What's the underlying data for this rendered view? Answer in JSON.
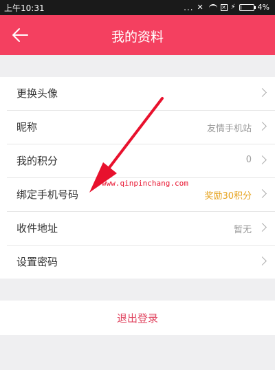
{
  "status_bar": {
    "time": "上午10:31",
    "dots": "...",
    "battery_percent": "4%",
    "battery_level": 0.04,
    "icons": [
      "signal-dots-icon",
      "mute-icon",
      "wifi-icon",
      "sim-icon",
      "charging-icon",
      "battery-icon"
    ]
  },
  "header": {
    "title": "我的资料",
    "back_icon": "back-arrow-icon",
    "color": "#f44060"
  },
  "rows": [
    {
      "label": "更换头像",
      "value": ""
    },
    {
      "label": "昵称",
      "value": "友情手机站"
    },
    {
      "label": "我的积分",
      "value": "0"
    },
    {
      "label": "绑定手机号码",
      "value": "奖励30积分"
    },
    {
      "label": "收件地址",
      "value": "暂无"
    },
    {
      "label": "设置密码",
      "value": ""
    }
  ],
  "accent_value_color": "#e6a21c",
  "logout": {
    "label": "退出登录",
    "color": "#e0445f"
  },
  "overlay": {
    "watermark": "www.qinpinchang.com",
    "arrow_color": "#e8112d"
  }
}
